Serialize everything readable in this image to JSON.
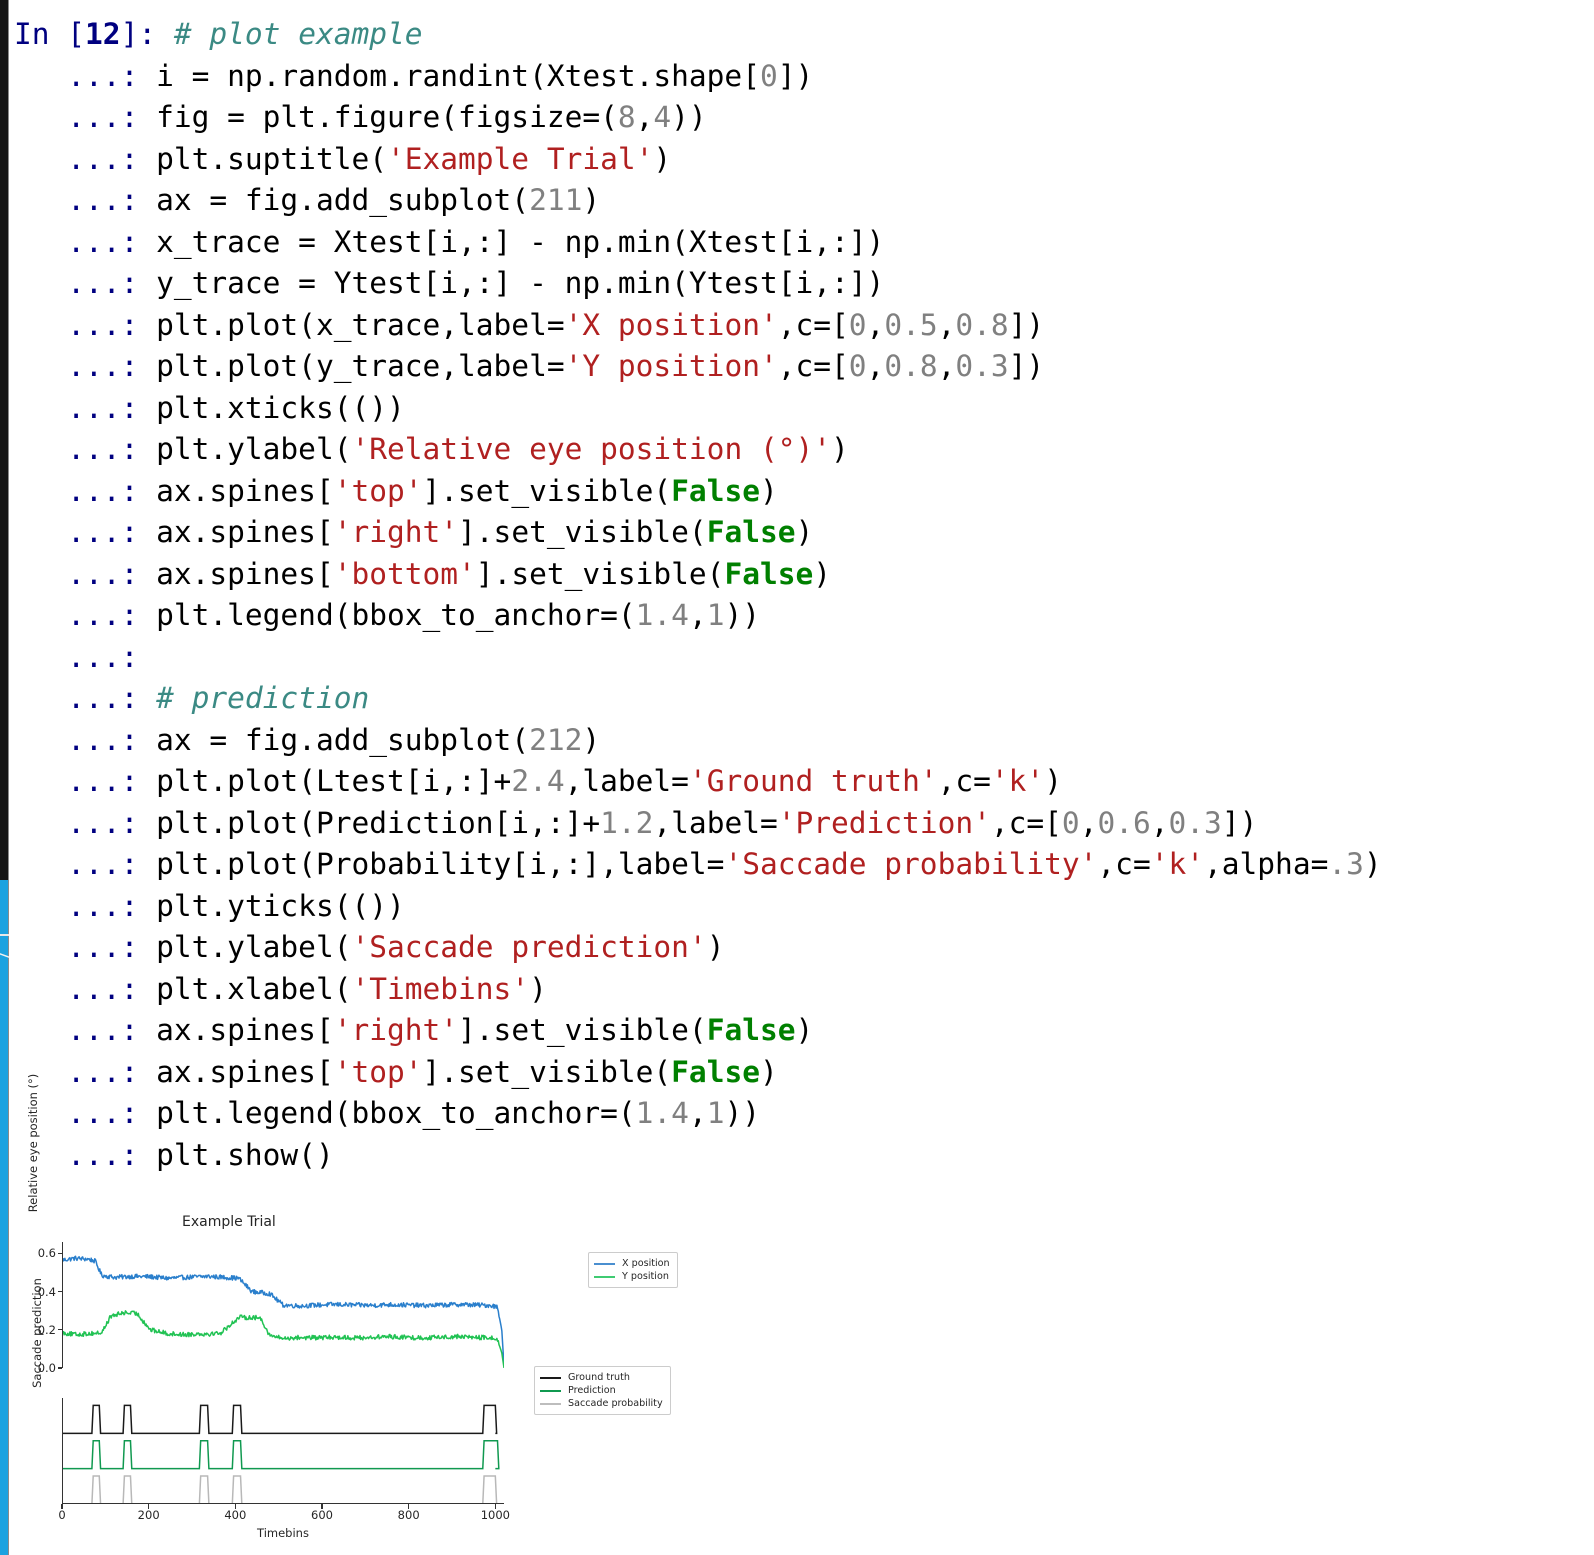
{
  "notebook": {
    "prompt_in_label": "In [",
    "prompt_in_number": "12",
    "prompt_in_close": "]:",
    "continuation_prompt": "...:",
    "code_lines": [
      {
        "prompt": "in",
        "tokens": [
          {
            "t": "# plot example",
            "c": "cmt"
          }
        ]
      },
      {
        "prompt": "cont",
        "tokens": [
          {
            "t": "i = np.random.randint(Xtest.shape[",
            "c": "plain"
          },
          {
            "t": "0",
            "c": "num"
          },
          {
            "t": "])",
            "c": "plain"
          }
        ]
      },
      {
        "prompt": "cont",
        "tokens": [
          {
            "t": "fig = plt.figure(figsize=(",
            "c": "plain"
          },
          {
            "t": "8",
            "c": "num"
          },
          {
            "t": ",",
            "c": "plain"
          },
          {
            "t": "4",
            "c": "num"
          },
          {
            "t": "))",
            "c": "plain"
          }
        ]
      },
      {
        "prompt": "cont",
        "tokens": [
          {
            "t": "plt.suptitle(",
            "c": "plain"
          },
          {
            "t": "'Example Trial'",
            "c": "str"
          },
          {
            "t": ")",
            "c": "plain"
          }
        ]
      },
      {
        "prompt": "cont",
        "tokens": [
          {
            "t": "ax = fig.add_subplot(",
            "c": "plain"
          },
          {
            "t": "211",
            "c": "num"
          },
          {
            "t": ")",
            "c": "plain"
          }
        ]
      },
      {
        "prompt": "cont",
        "tokens": [
          {
            "t": "x_trace = Xtest[i,:] - np.min(Xtest[i,:])",
            "c": "plain"
          }
        ]
      },
      {
        "prompt": "cont",
        "tokens": [
          {
            "t": "y_trace = Ytest[i,:] - np.min(Ytest[i,:])",
            "c": "plain"
          }
        ]
      },
      {
        "prompt": "cont",
        "tokens": [
          {
            "t": "plt.plot(x_trace,label=",
            "c": "plain"
          },
          {
            "t": "'X position'",
            "c": "str"
          },
          {
            "t": ",c=[",
            "c": "plain"
          },
          {
            "t": "0",
            "c": "num"
          },
          {
            "t": ",",
            "c": "plain"
          },
          {
            "t": "0.5",
            "c": "num"
          },
          {
            "t": ",",
            "c": "plain"
          },
          {
            "t": "0.8",
            "c": "num"
          },
          {
            "t": "])",
            "c": "plain"
          }
        ]
      },
      {
        "prompt": "cont",
        "tokens": [
          {
            "t": "plt.plot(y_trace,label=",
            "c": "plain"
          },
          {
            "t": "'Y position'",
            "c": "str"
          },
          {
            "t": ",c=[",
            "c": "plain"
          },
          {
            "t": "0",
            "c": "num"
          },
          {
            "t": ",",
            "c": "plain"
          },
          {
            "t": "0.8",
            "c": "num"
          },
          {
            "t": ",",
            "c": "plain"
          },
          {
            "t": "0.3",
            "c": "num"
          },
          {
            "t": "])",
            "c": "plain"
          }
        ]
      },
      {
        "prompt": "cont",
        "tokens": [
          {
            "t": "plt.xticks(())",
            "c": "plain"
          }
        ]
      },
      {
        "prompt": "cont",
        "tokens": [
          {
            "t": "plt.ylabel(",
            "c": "plain"
          },
          {
            "t": "'Relative eye position (°)'",
            "c": "str"
          },
          {
            "t": ")",
            "c": "plain"
          }
        ]
      },
      {
        "prompt": "cont",
        "tokens": [
          {
            "t": "ax.spines[",
            "c": "plain"
          },
          {
            "t": "'top'",
            "c": "str"
          },
          {
            "t": "].set_visible(",
            "c": "plain"
          },
          {
            "t": "False",
            "c": "kw"
          },
          {
            "t": ")",
            "c": "plain"
          }
        ]
      },
      {
        "prompt": "cont",
        "tokens": [
          {
            "t": "ax.spines[",
            "c": "plain"
          },
          {
            "t": "'right'",
            "c": "str"
          },
          {
            "t": "].set_visible(",
            "c": "plain"
          },
          {
            "t": "False",
            "c": "kw"
          },
          {
            "t": ")",
            "c": "plain"
          }
        ]
      },
      {
        "prompt": "cont",
        "tokens": [
          {
            "t": "ax.spines[",
            "c": "plain"
          },
          {
            "t": "'bottom'",
            "c": "str"
          },
          {
            "t": "].set_visible(",
            "c": "plain"
          },
          {
            "t": "False",
            "c": "kw"
          },
          {
            "t": ")",
            "c": "plain"
          }
        ]
      },
      {
        "prompt": "cont",
        "tokens": [
          {
            "t": "plt.legend(bbox_to_anchor=(",
            "c": "plain"
          },
          {
            "t": "1.4",
            "c": "num"
          },
          {
            "t": ",",
            "c": "plain"
          },
          {
            "t": "1",
            "c": "num"
          },
          {
            "t": "))",
            "c": "plain"
          }
        ]
      },
      {
        "prompt": "cont",
        "tokens": [
          {
            "t": "",
            "c": "plain"
          }
        ]
      },
      {
        "prompt": "cont",
        "tokens": [
          {
            "t": "# prediction",
            "c": "cmt"
          }
        ]
      },
      {
        "prompt": "cont",
        "tokens": [
          {
            "t": "ax = fig.add_subplot(",
            "c": "plain"
          },
          {
            "t": "212",
            "c": "num"
          },
          {
            "t": ")",
            "c": "plain"
          }
        ]
      },
      {
        "prompt": "cont",
        "tokens": [
          {
            "t": "plt.plot(Ltest[i,:]+",
            "c": "plain"
          },
          {
            "t": "2.4",
            "c": "num"
          },
          {
            "t": ",label=",
            "c": "plain"
          },
          {
            "t": "'Ground truth'",
            "c": "str"
          },
          {
            "t": ",c=",
            "c": "plain"
          },
          {
            "t": "'k'",
            "c": "str"
          },
          {
            "t": ")",
            "c": "plain"
          }
        ]
      },
      {
        "prompt": "cont",
        "tokens": [
          {
            "t": "plt.plot(Prediction[i,:]+",
            "c": "plain"
          },
          {
            "t": "1.2",
            "c": "num"
          },
          {
            "t": ",label=",
            "c": "plain"
          },
          {
            "t": "'Prediction'",
            "c": "str"
          },
          {
            "t": ",c=[",
            "c": "plain"
          },
          {
            "t": "0",
            "c": "num"
          },
          {
            "t": ",",
            "c": "plain"
          },
          {
            "t": "0.6",
            "c": "num"
          },
          {
            "t": ",",
            "c": "plain"
          },
          {
            "t": "0.3",
            "c": "num"
          },
          {
            "t": "])",
            "c": "plain"
          }
        ]
      },
      {
        "prompt": "cont",
        "tokens": [
          {
            "t": "plt.plot(Probability[i,:],label=",
            "c": "plain"
          },
          {
            "t": "'Saccade probability'",
            "c": "str"
          },
          {
            "t": ",c=",
            "c": "plain"
          },
          {
            "t": "'k'",
            "c": "str"
          },
          {
            "t": ",alpha=",
            "c": "plain"
          },
          {
            "t": ".3",
            "c": "num"
          },
          {
            "t": ")",
            "c": "plain"
          }
        ]
      },
      {
        "prompt": "cont",
        "tokens": [
          {
            "t": "plt.yticks(())",
            "c": "plain"
          }
        ]
      },
      {
        "prompt": "cont",
        "tokens": [
          {
            "t": "plt.ylabel(",
            "c": "plain"
          },
          {
            "t": "'Saccade prediction'",
            "c": "str"
          },
          {
            "t": ")",
            "c": "plain"
          }
        ]
      },
      {
        "prompt": "cont",
        "tokens": [
          {
            "t": "plt.xlabel(",
            "c": "plain"
          },
          {
            "t": "'Timebins'",
            "c": "str"
          },
          {
            "t": ")",
            "c": "plain"
          }
        ]
      },
      {
        "prompt": "cont",
        "tokens": [
          {
            "t": "ax.spines[",
            "c": "plain"
          },
          {
            "t": "'right'",
            "c": "str"
          },
          {
            "t": "].set_visible(",
            "c": "plain"
          },
          {
            "t": "False",
            "c": "kw"
          },
          {
            "t": ")",
            "c": "plain"
          }
        ]
      },
      {
        "prompt": "cont",
        "tokens": [
          {
            "t": "ax.spines[",
            "c": "plain"
          },
          {
            "t": "'top'",
            "c": "str"
          },
          {
            "t": "].set_visible(",
            "c": "plain"
          },
          {
            "t": "False",
            "c": "kw"
          },
          {
            "t": ")",
            "c": "plain"
          }
        ]
      },
      {
        "prompt": "cont",
        "tokens": [
          {
            "t": "plt.legend(bbox_to_anchor=(",
            "c": "plain"
          },
          {
            "t": "1.4",
            "c": "num"
          },
          {
            "t": ",",
            "c": "plain"
          },
          {
            "t": "1",
            "c": "num"
          },
          {
            "t": "))",
            "c": "plain"
          }
        ]
      },
      {
        "prompt": "cont",
        "tokens": [
          {
            "t": "plt.show()",
            "c": "plain"
          }
        ]
      }
    ]
  },
  "colors": {
    "prompt": "#000080",
    "comment": "#3b8a84",
    "string": "#b02020",
    "number": "#808080",
    "keyword": "#008000",
    "gutter_active": "#1ba2e0",
    "gutter_inactive": "#141414",
    "x_position": "#2a7fcc",
    "y_position": "#21c253",
    "ground_truth": "#1a1a1a",
    "prediction": "#109950",
    "saccade_probability": "#b8b8b8"
  },
  "chart_data": [
    {
      "type": "line",
      "title": "Example Trial",
      "subplot": "211",
      "xlabel": "",
      "ylabel": "Relative eye position (°)",
      "xlim": [
        0,
        1000
      ],
      "ylim": [
        0.0,
        0.66
      ],
      "yticks": [
        "0.0",
        "0.2",
        "0.4",
        "0.6"
      ],
      "ytick_values": [
        0.0,
        0.2,
        0.4,
        0.6
      ],
      "xticks": [],
      "grid": false,
      "legend_position": "right-outside",
      "series": [
        {
          "name": "X position",
          "color": "#2a7fcc",
          "x": [
            0,
            30,
            60,
            75,
            90,
            120,
            160,
            200,
            240,
            280,
            310,
            330,
            360,
            400,
            430,
            450,
            470,
            500,
            540,
            580,
            620,
            660,
            700,
            740,
            780,
            820,
            860,
            900,
            940,
            970,
            985,
            995,
            1000
          ],
          "values": [
            0.565,
            0.575,
            0.57,
            0.56,
            0.485,
            0.475,
            0.48,
            0.478,
            0.47,
            0.475,
            0.478,
            0.48,
            0.476,
            0.47,
            0.4,
            0.395,
            0.39,
            0.33,
            0.325,
            0.33,
            0.333,
            0.33,
            0.328,
            0.332,
            0.33,
            0.327,
            0.33,
            0.333,
            0.33,
            0.328,
            0.32,
            0.2,
            0.01
          ]
        },
        {
          "name": "Y position",
          "color": "#21c253",
          "x": [
            0,
            30,
            60,
            90,
            110,
            140,
            170,
            200,
            240,
            280,
            310,
            330,
            360,
            400,
            430,
            450,
            470,
            500,
            540,
            580,
            620,
            660,
            700,
            740,
            780,
            820,
            860,
            900,
            940,
            970,
            985,
            995,
            1000
          ],
          "values": [
            0.185,
            0.175,
            0.18,
            0.185,
            0.27,
            0.29,
            0.285,
            0.2,
            0.18,
            0.175,
            0.18,
            0.178,
            0.185,
            0.265,
            0.265,
            0.26,
            0.17,
            0.155,
            0.16,
            0.158,
            0.162,
            0.158,
            0.16,
            0.165,
            0.16,
            0.158,
            0.162,
            0.165,
            0.16,
            0.158,
            0.15,
            0.08,
            0.0
          ]
        }
      ],
      "noise_amplitude": 0.012
    },
    {
      "type": "line",
      "title": "",
      "subplot": "212",
      "xlabel": "Timebins",
      "ylabel": "Saccade prediction",
      "xlim": [
        0,
        1020
      ],
      "ylim": [
        0,
        3.6
      ],
      "xticks": [
        "0",
        "200",
        "400",
        "600",
        "800",
        "1000"
      ],
      "xtick_values": [
        0,
        200,
        400,
        600,
        800,
        1000
      ],
      "yticks": [],
      "grid": false,
      "legend_position": "right-outside",
      "series": [
        {
          "name": "Ground truth",
          "color": "#1a1a1a",
          "offset": 2.4,
          "pulses": [
            [
              72,
              86
            ],
            [
              144,
              158
            ],
            [
              320,
              336
            ],
            [
              396,
              412
            ],
            [
              974,
              1000
            ]
          ]
        },
        {
          "name": "Prediction",
          "color": "#109950",
          "offset": 1.2,
          "pulses": [
            [
              72,
              86
            ],
            [
              144,
              158
            ],
            [
              320,
              336
            ],
            [
              396,
              412
            ],
            [
              974,
              1005
            ]
          ]
        },
        {
          "name": "Saccade probability",
          "color": "#b8b8b8",
          "offset": 0.0,
          "pulses": [
            [
              72,
              86
            ],
            [
              144,
              158
            ],
            [
              320,
              336
            ],
            [
              396,
              412
            ],
            [
              974,
              1000
            ]
          ]
        }
      ]
    }
  ],
  "legend_top": {
    "entries": [
      {
        "label": "X position",
        "color": "#4a8fd0"
      },
      {
        "label": "Y position",
        "color": "#3fcb72"
      }
    ]
  },
  "legend_bottom": {
    "entries": [
      {
        "label": "Ground truth",
        "color": "#1a1a1a"
      },
      {
        "label": "Prediction",
        "color": "#109950"
      },
      {
        "label": "Saccade probability",
        "color": "#bdbdbd"
      }
    ]
  }
}
